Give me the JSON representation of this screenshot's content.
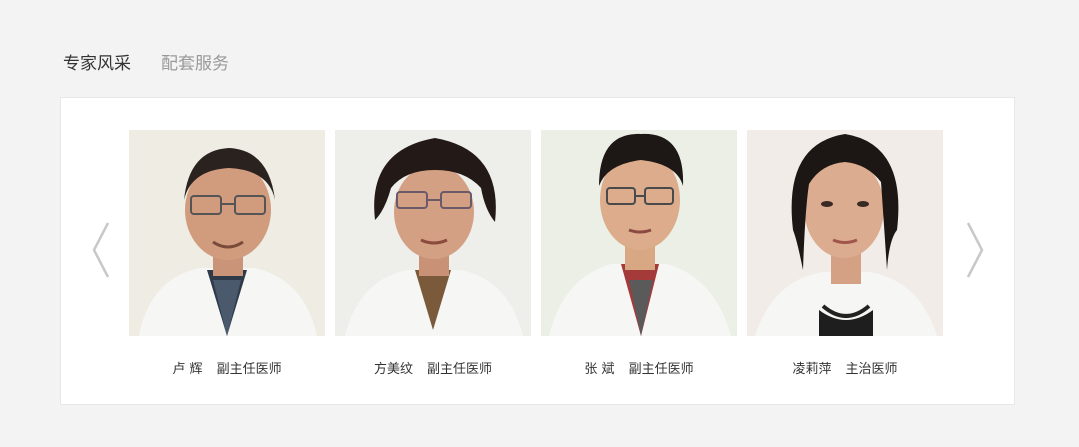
{
  "tabs": [
    {
      "label": "专家风采",
      "active": true
    },
    {
      "label": "配套服务",
      "active": false
    }
  ],
  "carousel": {
    "prev_icon": "chevron-left-icon",
    "next_icon": "chevron-right-icon",
    "experts": [
      {
        "name": "卢  辉",
        "title": "副主任医师"
      },
      {
        "name": "方美纹",
        "title": "副主任医师"
      },
      {
        "name": "张  斌",
        "title": "副主任医师"
      },
      {
        "name": "凌莉萍",
        "title": "主治医师"
      }
    ]
  },
  "colors": {
    "page_bg": "#f3f3f3",
    "panel_bg": "#ffffff",
    "active_tab": "#333333",
    "inactive_tab": "#999999",
    "arrow": "#c8c8c8"
  }
}
